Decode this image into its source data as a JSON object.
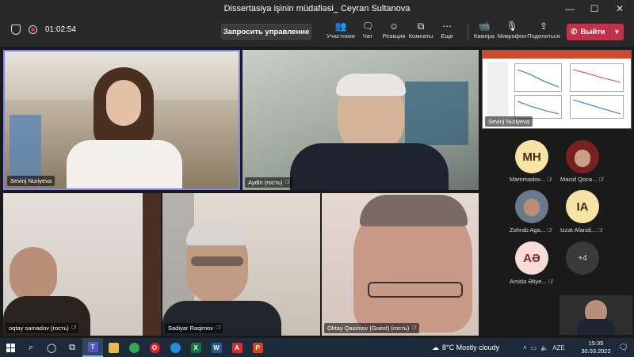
{
  "window": {
    "title": "Dissertasiya işinin müdafiəsi_ Ceyran Sultanova"
  },
  "toolbar": {
    "timer": "01:02:54",
    "request_control": "Запросить управление",
    "participants": "Участники",
    "chat": "Чат",
    "reactions": "Реакции",
    "rooms": "Комнаты",
    "more": "Еще",
    "camera": "Камера",
    "mic": "Микрофон",
    "share": "Поделиться",
    "leave": "Выйти"
  },
  "tiles": [
    {
      "name": "Sevinj Nuriyeva",
      "muted": false
    },
    {
      "name": "Aydin (гость)",
      "muted": true
    },
    {
      "name": "oqtay samadov (гость)",
      "muted": true
    },
    {
      "name": "Sadiyar Raqimov",
      "muted": true
    },
    {
      "name": "Oktay Qasimov (Guest) (гость)",
      "muted": true
    }
  ],
  "share_label": "Sevinj Nuriyeva",
  "side_participants": [
    {
      "initials": "MH",
      "name": "Mammadov...",
      "color": "#f7e3a6"
    },
    {
      "initials": "",
      "name": "Macid Qoca...",
      "color": "#8a2a2a"
    },
    {
      "initials": "",
      "name": "Zohrab Aga...",
      "color": "#6a7a8a"
    },
    {
      "initials": "IA",
      "name": "Izzat Afandi...",
      "color": "#f7e3a6"
    },
    {
      "initials": "AƏ",
      "name": "Amida Əliye...",
      "color": "#f8dcd8"
    }
  ],
  "more_count": "+4",
  "taskbar": {
    "weather": "8°C  Mostly cloudy",
    "lang": "AZE",
    "time": "15:35",
    "date": "30.03.2022"
  }
}
